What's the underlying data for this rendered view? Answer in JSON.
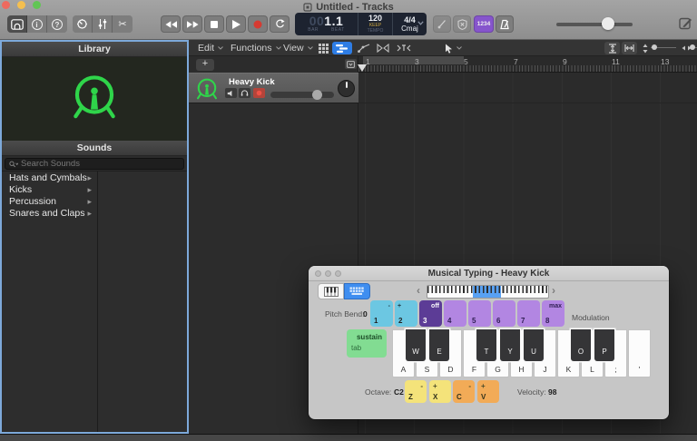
{
  "window": {
    "title": "Untitled - Tracks"
  },
  "transport": {
    "lcd": {
      "bar_dim": "00",
      "bar_beat": "1.1",
      "bar_label": "BAR",
      "beat_label": "BEAT",
      "tempo": "120",
      "tempo_mode": "KEEP",
      "tempo_label": "TEMPO",
      "time_signature": "4/4",
      "key_signature": "Cmaj"
    },
    "count_in_label": "1234"
  },
  "library": {
    "title": "Library",
    "sounds_header": "Sounds",
    "search_placeholder": "Search Sounds",
    "categories": [
      {
        "label": "Hats and Cymbals"
      },
      {
        "label": "Kicks"
      },
      {
        "label": "Percussion"
      },
      {
        "label": "Snares and Claps"
      }
    ]
  },
  "tracks": {
    "menus": [
      {
        "label": "Edit"
      },
      {
        "label": "Functions"
      },
      {
        "label": "View"
      }
    ],
    "track": {
      "name": "Heavy Kick"
    },
    "ruler": {
      "marks": [
        "1",
        "3",
        "5",
        "7",
        "9",
        "11",
        "13"
      ]
    }
  },
  "musical_typing": {
    "title": "Musical Typing - Heavy Kick",
    "pitch_bend_label": "Pitch Bend:",
    "pitch_bend_value": "0",
    "modulation_label": "Modulation",
    "pitch_keys": [
      {
        "num": "1",
        "mod": "-"
      },
      {
        "num": "2",
        "mod": "+"
      },
      {
        "num": "3",
        "mod": "off"
      },
      {
        "num": "4",
        "mod": ""
      },
      {
        "num": "5",
        "mod": ""
      },
      {
        "num": "6",
        "mod": ""
      },
      {
        "num": "7",
        "mod": ""
      },
      {
        "num": "8",
        "mod": "max"
      }
    ],
    "sustain_label": "sustain",
    "sustain_key": "tab",
    "white_keys": [
      "A",
      "S",
      "D",
      "F",
      "G",
      "H",
      "J",
      "K",
      "L",
      ";",
      "'"
    ],
    "black_keys": [
      "W",
      "E",
      "T",
      "Y",
      "U",
      "O",
      "P"
    ],
    "octave_label": "Octave:",
    "octave_value": "C2",
    "octave_keys": [
      {
        "key": "Z",
        "mod": "-"
      },
      {
        "key": "X",
        "mod": "+"
      }
    ],
    "modulation_keys": [
      {
        "key": "C",
        "mod": "-"
      },
      {
        "key": "V",
        "mod": "+"
      }
    ],
    "velocity_label": "Velocity:",
    "velocity_value": "98"
  },
  "icons": {
    "info_glyph": "i",
    "help_glyph": "?",
    "scissors_glyph": "✂",
    "plus_glyph": "+",
    "tri_right": "▸",
    "chev_left": "‹",
    "chev_right": "›"
  },
  "colors": {
    "accent_blue": "#2e7de5",
    "focus_border": "#7da9da",
    "kick_green": "#2fd54a",
    "record_red": "#d63a31",
    "count_in_purple": "#8655cc",
    "lcd_bg": "#1d2330",
    "key_cyan": "#6cc7e2",
    "key_purple_dark": "#5c3c96",
    "key_purple_light": "#b286e2",
    "key_green": "#82dc92",
    "key_yellow": "#f4e37a",
    "key_orange": "#f2ab57"
  }
}
